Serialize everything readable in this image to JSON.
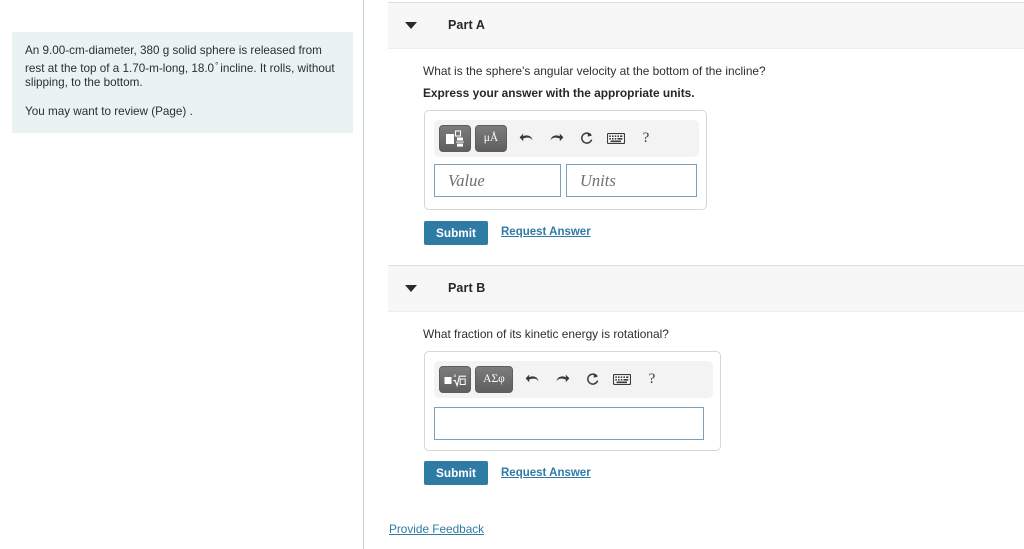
{
  "problem": {
    "text_before_degree": "An 9.00-cm-diameter, 380 g solid sphere is released from rest at the top of a 1.70-m-long, 18.0",
    "degree_symbol": "°",
    "text_after_degree": "incline. It rolls, without slipping, to the bottom.",
    "review_line": "You may want to review (Page) ."
  },
  "parts": [
    {
      "id": "part-a",
      "title": "Part A",
      "caret_icon": "caret-down-icon",
      "question": "What is the sphere's angular velocity at the bottom of the incline?",
      "instruction": "Express your answer with the appropriate units.",
      "toolbar": {
        "template_button_label": "",
        "template_button_icon": "math-template-icon",
        "units_button_label": "μÅ",
        "units_button_icon": "units-icon",
        "undo_icon": "undo-icon",
        "redo_icon": "redo-icon",
        "reset_icon": "reset-icon",
        "keyboard_icon": "keyboard-icon",
        "help_label": "?",
        "help_icon": "help-icon"
      },
      "inputs": [
        {
          "name": "value-input",
          "placeholder": "Value",
          "value": ""
        },
        {
          "name": "units-input",
          "placeholder": "Units",
          "value": ""
        }
      ],
      "submit_label": "Submit",
      "request_answer_label": "Request Answer"
    },
    {
      "id": "part-b",
      "title": "Part B",
      "caret_icon": "caret-down-icon",
      "question": "What fraction of its kinetic energy is rotational?",
      "instruction": "",
      "toolbar": {
        "template_button_label": "",
        "template_button_icon": "math-radical-icon",
        "units_button_label": "ΑΣφ",
        "units_button_icon": "greek-symbols-icon",
        "undo_icon": "undo-icon",
        "redo_icon": "redo-icon",
        "reset_icon": "reset-icon",
        "keyboard_icon": "keyboard-icon",
        "help_label": "?",
        "help_icon": "help-icon"
      },
      "inputs": [
        {
          "name": "answer-input",
          "placeholder": "",
          "value": ""
        }
      ],
      "submit_label": "Submit",
      "request_answer_label": "Request Answer"
    }
  ],
  "footer": {
    "provide_feedback_label": "Provide Feedback"
  },
  "colors": {
    "accent_blue": "#2e7ba6",
    "info_box_bg": "#e9f3f4",
    "header_bg": "#f7f7f7",
    "input_border": "#7ba0bd"
  }
}
